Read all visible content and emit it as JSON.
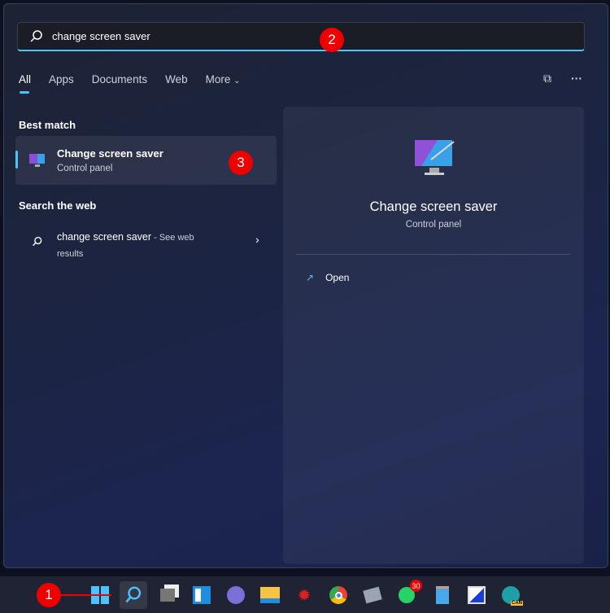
{
  "search": {
    "value": "change screen saver",
    "icon": "search-icon"
  },
  "tabs": [
    {
      "label": "All",
      "active": true
    },
    {
      "label": "Apps"
    },
    {
      "label": "Documents"
    },
    {
      "label": "Web"
    },
    {
      "label": "More"
    }
  ],
  "best_match": {
    "heading": "Best match",
    "title": "Change screen saver",
    "subtitle": "Control panel"
  },
  "web": {
    "heading": "Search the web",
    "query": "change screen saver",
    "suffix": " - See web",
    "suffix2": "results"
  },
  "preview": {
    "title": "Change screen saver",
    "subtitle": "Control panel",
    "action": "Open"
  },
  "annotations": [
    "1",
    "2",
    "3"
  ],
  "taskbar": {
    "whatsapp_badge": "30",
    "edge_label": "CAN"
  },
  "colors": {
    "accent": "#4cc2ff",
    "annotation": "#e00000"
  }
}
